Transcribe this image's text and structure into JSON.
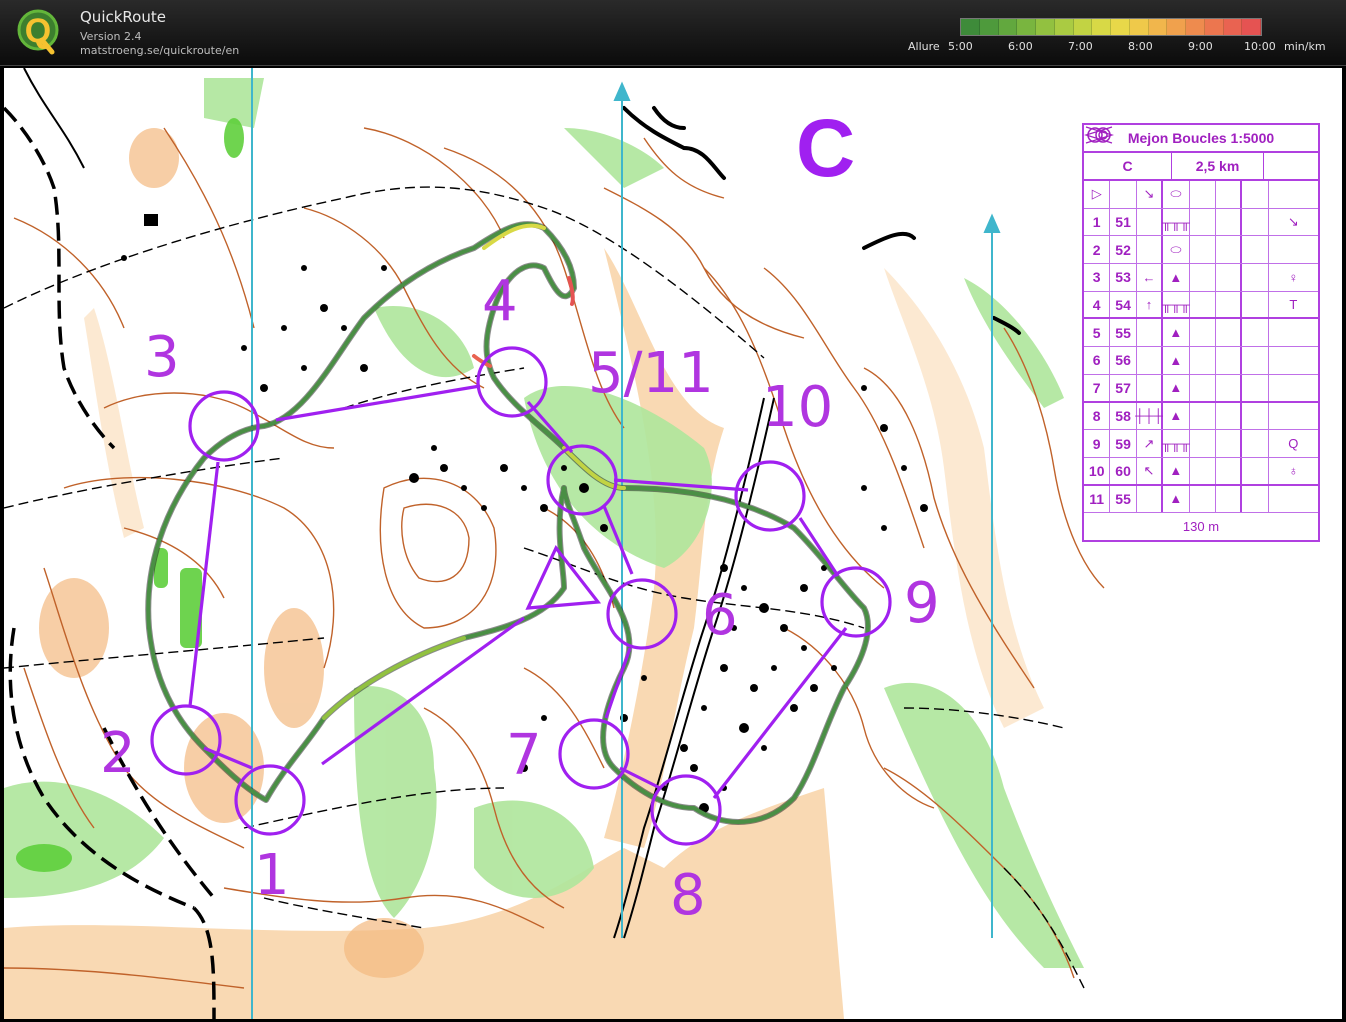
{
  "app": {
    "title": "QuickRoute",
    "version": "Version 2.4",
    "url": "matstroeng.se/quickroute/en",
    "logo_letter": "Q"
  },
  "pace_scale": {
    "label": "Allure",
    "ticks": [
      "5:00",
      "6:00",
      "7:00",
      "8:00",
      "9:00",
      "10:00"
    ],
    "unit": "min/km",
    "colors": [
      "#3e8b3a",
      "#4e9a3c",
      "#62a83e",
      "#79b53f",
      "#92c140",
      "#aacb42",
      "#c2d343",
      "#d8d946",
      "#e8d849",
      "#efc94a",
      "#f1b64c",
      "#f0a14d",
      "#ee8b4e",
      "#ec764f",
      "#e96351",
      "#e55352"
    ]
  },
  "map": {
    "course_letter": "C",
    "controls": [
      {
        "number": "1"
      },
      {
        "number": "2"
      },
      {
        "number": "3"
      },
      {
        "number": "4"
      },
      {
        "number": "5/11"
      },
      {
        "number": "6"
      },
      {
        "number": "7"
      },
      {
        "number": "8"
      },
      {
        "number": "9"
      },
      {
        "number": "10"
      }
    ],
    "colors": {
      "course": "#a020f0",
      "route_green": "#3a7d3a",
      "contour": "#c0622a",
      "vegetation": "#8fd67a",
      "open_land": "#f7c897",
      "north_line": "#3fb6cc"
    }
  },
  "description_sheet": {
    "title": "Mejon Boucles 1:5000",
    "course": "C",
    "length": "2,5 km",
    "start_row": [
      "▷",
      "",
      "↘",
      "⬭",
      "",
      "",
      "",
      ""
    ],
    "rows": [
      {
        "num": "1",
        "code": "51",
        "c": "",
        "d": "╥╥╥",
        "e": "",
        "f": "",
        "g": "",
        "h": "↘"
      },
      {
        "num": "2",
        "code": "52",
        "c": "",
        "d": "⬭",
        "e": "",
        "f": "",
        "g": "",
        "h": ""
      },
      {
        "num": "3",
        "code": "53",
        "c": "←",
        "d": "▲",
        "e": "",
        "f": "",
        "g": "",
        "h": "♀"
      },
      {
        "num": "4",
        "code": "54",
        "c": "↑",
        "d": "╥╥╥",
        "e": "",
        "f": "",
        "g": "",
        "h": "T"
      },
      {
        "num": "5",
        "code": "55",
        "c": "",
        "d": "▲",
        "e": "",
        "f": "",
        "g": "",
        "h": ""
      },
      {
        "num": "6",
        "code": "56",
        "c": "",
        "d": "▲",
        "e": "",
        "f": "",
        "g": "",
        "h": ""
      },
      {
        "num": "7",
        "code": "57",
        "c": "",
        "d": "▲",
        "e": "",
        "f": "",
        "g": "",
        "h": ""
      },
      {
        "num": "8",
        "code": "58",
        "c": "┼┼┼",
        "d": "▲",
        "e": "",
        "f": "",
        "g": "",
        "h": ""
      },
      {
        "num": "9",
        "code": "59",
        "c": "↗",
        "d": "╥╥╥",
        "e": "",
        "f": "",
        "g": "",
        "h": "Q"
      },
      {
        "num": "10",
        "code": "60",
        "c": "↖",
        "d": "▲",
        "e": "",
        "f": "",
        "g": "",
        "h": "♁"
      },
      {
        "num": "11",
        "code": "55",
        "c": "",
        "d": "▲",
        "e": "",
        "f": "",
        "g": "",
        "h": ""
      }
    ],
    "finish_distance": "130 m"
  }
}
